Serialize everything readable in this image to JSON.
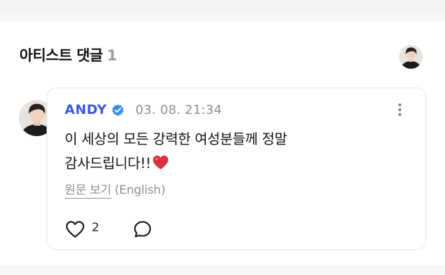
{
  "section": {
    "title": "아티스트 댓글",
    "count": "1"
  },
  "comment": {
    "author": "ANDY",
    "timestamp": "03. 08. 21:34",
    "text_line1": "이 세상의 모든 강력한 여성분들께 정말",
    "text_line2": "감사드립니다!!",
    "translate_label": "원문 보기",
    "translate_lang": "(English)",
    "like_count": "2"
  },
  "colors": {
    "accent": "#3e58d8",
    "verified": "#3d8fe8",
    "muted": "#8e8e96",
    "heart_emoji": "#e02d3c"
  },
  "icons": {
    "verified": "verified-badge-icon",
    "more": "more-vertical-icon",
    "like": "heart-outline-icon",
    "reply": "speech-bubble-icon",
    "emoji": "red-heart-emoji"
  }
}
